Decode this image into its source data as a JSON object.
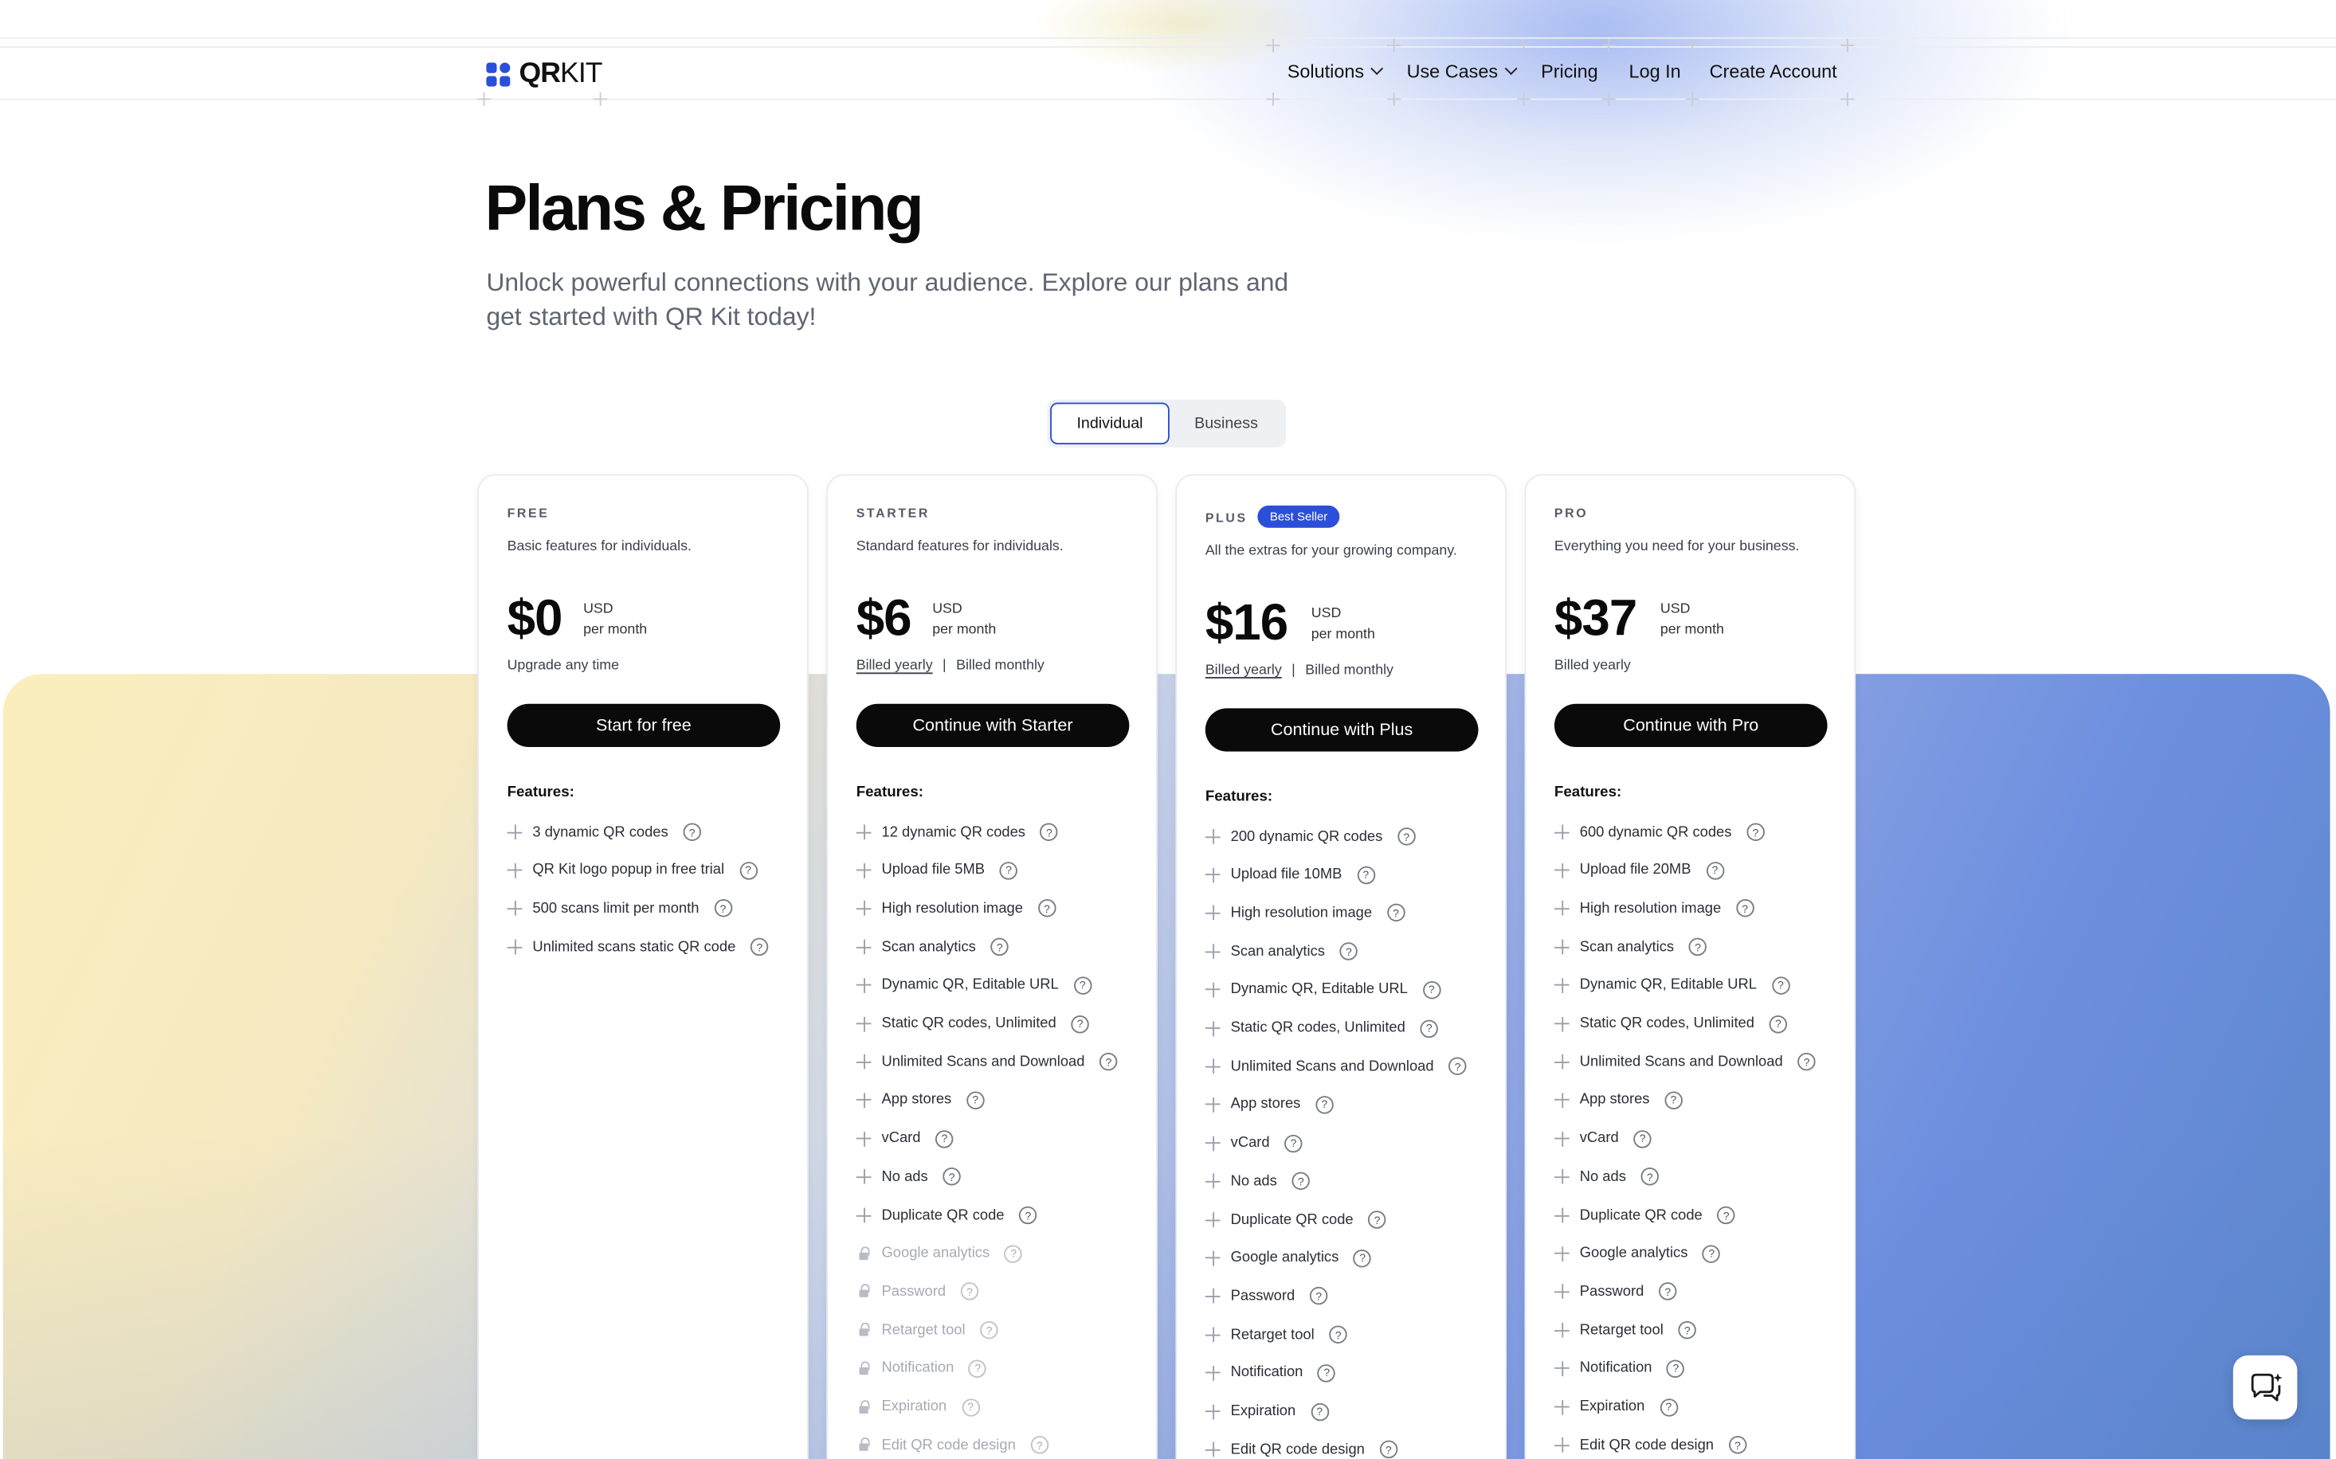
{
  "brand": {
    "logo_bold": "QR",
    "logo_light": "KIT",
    "accent": "#2b4fd8"
  },
  "nav": {
    "solutions": "Solutions",
    "use_cases": "Use Cases",
    "pricing": "Pricing",
    "login": "Log In",
    "create_account": "Create Account"
  },
  "hero": {
    "title": "Plans & Pricing",
    "subtitle": "Unlock powerful connections with your audience. Explore our plans and get started with QR Kit today!"
  },
  "toggle": {
    "individual": "Individual",
    "business": "Business",
    "selected": "Individual"
  },
  "features_label": "Features:",
  "plans": [
    {
      "name": "FREE",
      "desc": "Basic features for individuals.",
      "price": "$0",
      "currency": "USD",
      "period": "per month",
      "billing_note": "Upgrade any time",
      "cta": "Start for free",
      "features": [
        {
          "label": "3 dynamic QR codes",
          "locked": false
        },
        {
          "label": "QR Kit logo popup in free trial",
          "locked": false
        },
        {
          "label": "500 scans limit per month",
          "locked": false
        },
        {
          "label": "Unlimited scans static QR code",
          "locked": false
        }
      ]
    },
    {
      "name": "STARTER",
      "desc": "Standard features for individuals.",
      "price": "$6",
      "currency": "USD",
      "period": "per month",
      "billed_yearly": "Billed yearly",
      "separator": "|",
      "billed_monthly": "Billed monthly",
      "cta": "Continue with Starter",
      "features": [
        {
          "label": "12 dynamic QR codes",
          "locked": false
        },
        {
          "label": "Upload file 5MB",
          "locked": false
        },
        {
          "label": "High resolution image",
          "locked": false
        },
        {
          "label": "Scan analytics",
          "locked": false
        },
        {
          "label": "Dynamic QR, Editable URL",
          "locked": false
        },
        {
          "label": "Static QR codes, Unlimited",
          "locked": false
        },
        {
          "label": "Unlimited Scans and Download",
          "locked": false
        },
        {
          "label": "App stores",
          "locked": false
        },
        {
          "label": "vCard",
          "locked": false
        },
        {
          "label": "No ads",
          "locked": false
        },
        {
          "label": "Duplicate QR code",
          "locked": false
        },
        {
          "label": "Google analytics",
          "locked": true
        },
        {
          "label": "Password",
          "locked": true
        },
        {
          "label": "Retarget tool",
          "locked": true
        },
        {
          "label": "Notification",
          "locked": true
        },
        {
          "label": "Expiration",
          "locked": true
        },
        {
          "label": "Edit QR code design",
          "locked": true
        }
      ]
    },
    {
      "name": "PLUS",
      "badge": "Best Seller",
      "desc": "All the extras for your growing company.",
      "price": "$16",
      "currency": "USD",
      "period": "per month",
      "billed_yearly": "Billed yearly",
      "separator": "|",
      "billed_monthly": "Billed monthly",
      "cta": "Continue with Plus",
      "features": [
        {
          "label": "200 dynamic QR codes",
          "locked": false
        },
        {
          "label": "Upload file 10MB",
          "locked": false
        },
        {
          "label": "High resolution image",
          "locked": false
        },
        {
          "label": "Scan analytics",
          "locked": false
        },
        {
          "label": "Dynamic QR, Editable URL",
          "locked": false
        },
        {
          "label": "Static QR codes, Unlimited",
          "locked": false
        },
        {
          "label": "Unlimited Scans and Download",
          "locked": false
        },
        {
          "label": "App stores",
          "locked": false
        },
        {
          "label": "vCard",
          "locked": false
        },
        {
          "label": "No ads",
          "locked": false
        },
        {
          "label": "Duplicate QR code",
          "locked": false
        },
        {
          "label": "Google analytics",
          "locked": false
        },
        {
          "label": "Password",
          "locked": false
        },
        {
          "label": "Retarget tool",
          "locked": false
        },
        {
          "label": "Notification",
          "locked": false
        },
        {
          "label": "Expiration",
          "locked": false
        },
        {
          "label": "Edit QR code design",
          "locked": false
        }
      ]
    },
    {
      "name": "PRO",
      "desc": "Everything you need for your business.",
      "price": "$37",
      "currency": "USD",
      "period": "per month",
      "billing_note": "Billed yearly",
      "cta": "Continue with Pro",
      "features": [
        {
          "label": "600 dynamic QR codes",
          "locked": false
        },
        {
          "label": "Upload file 20MB",
          "locked": false
        },
        {
          "label": "High resolution image",
          "locked": false
        },
        {
          "label": "Scan analytics",
          "locked": false
        },
        {
          "label": "Dynamic QR, Editable URL",
          "locked": false
        },
        {
          "label": "Static QR codes, Unlimited",
          "locked": false
        },
        {
          "label": "Unlimited Scans and Download",
          "locked": false
        },
        {
          "label": "App stores",
          "locked": false
        },
        {
          "label": "vCard",
          "locked": false
        },
        {
          "label": "No ads",
          "locked": false
        },
        {
          "label": "Duplicate QR code",
          "locked": false
        },
        {
          "label": "Google analytics",
          "locked": false
        },
        {
          "label": "Password",
          "locked": false
        },
        {
          "label": "Retarget tool",
          "locked": false
        },
        {
          "label": "Notification",
          "locked": false
        },
        {
          "label": "Expiration",
          "locked": false
        },
        {
          "label": "Edit QR code design",
          "locked": false
        }
      ]
    }
  ],
  "chat_widget": {
    "icon": "chat-bubble-icon"
  }
}
